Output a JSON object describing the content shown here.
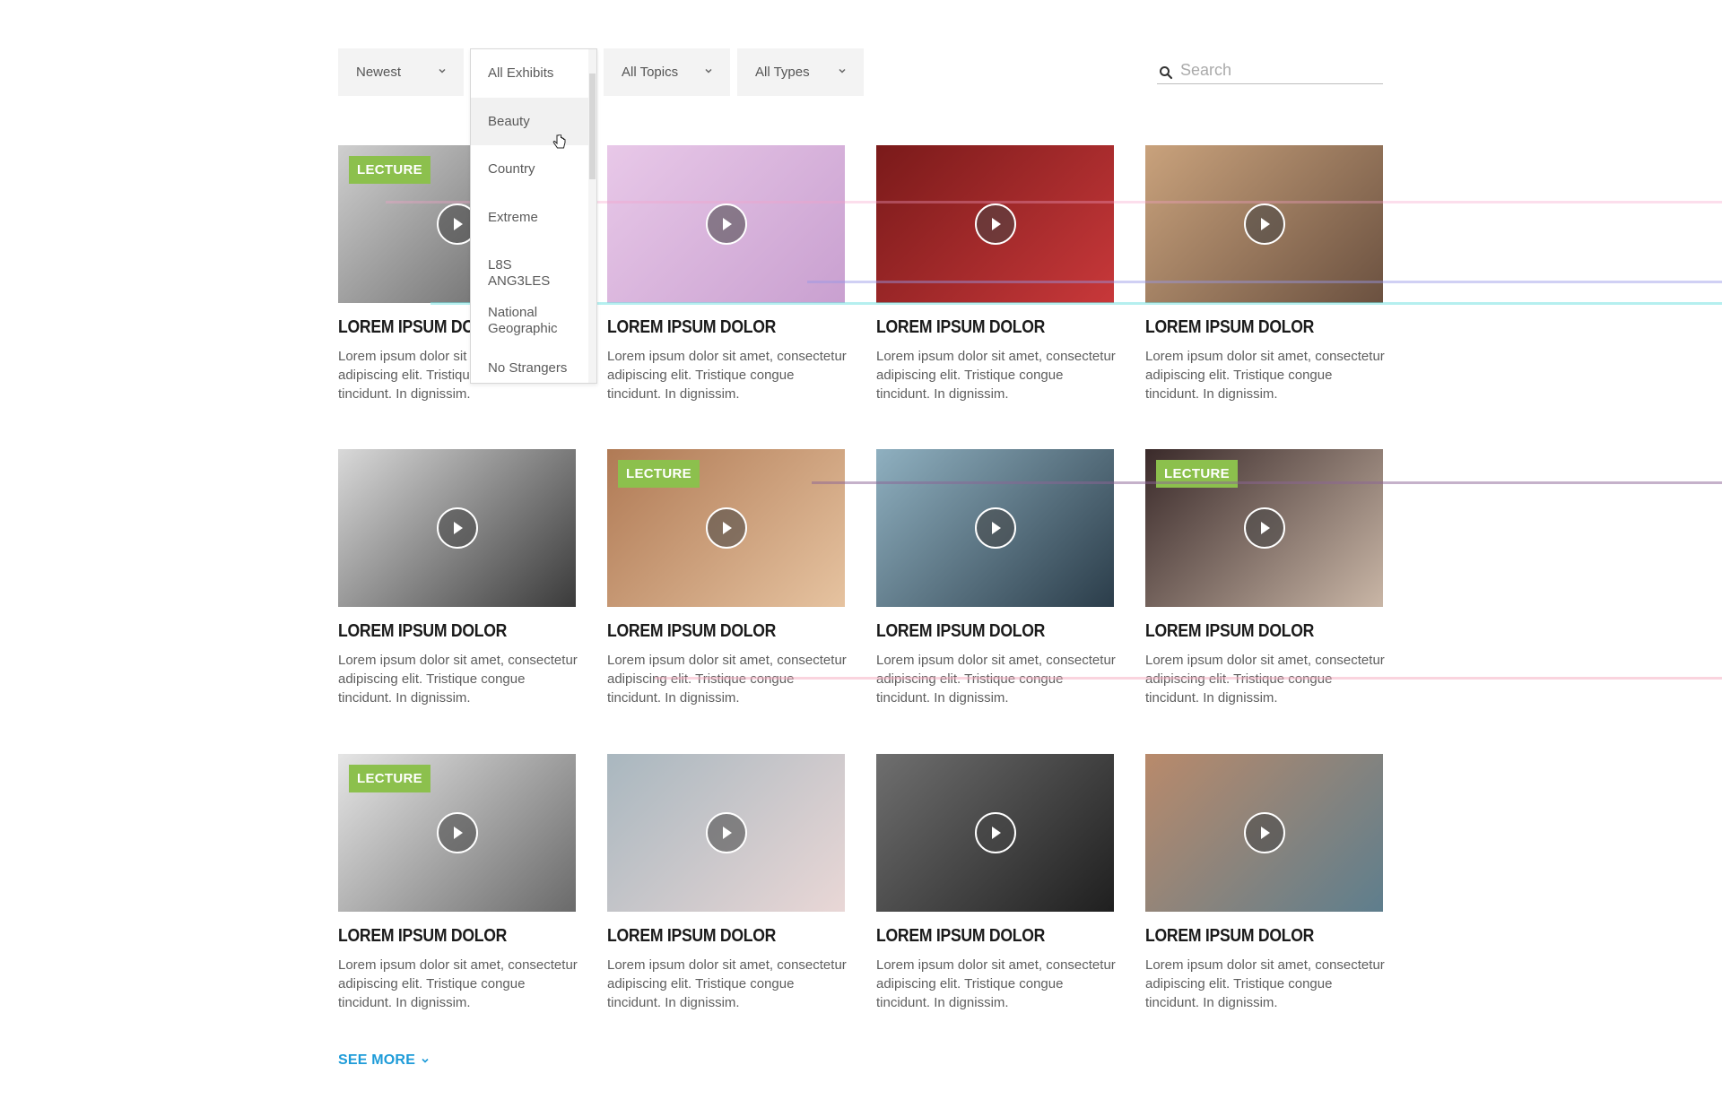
{
  "filters": {
    "sort": {
      "label": "Newest"
    },
    "exhibits": {
      "label": "All Exhibits",
      "options": [
        "Beauty",
        "Country",
        "Extreme",
        "L8S ANG3LES",
        "National Geographic",
        "No Strangers"
      ]
    },
    "topics": {
      "label": "All Topics"
    },
    "types": {
      "label": "All Types"
    }
  },
  "search": {
    "placeholder": "Search"
  },
  "cards": [
    {
      "badge": "LECTURE",
      "title": "LOREM IPSUM DOLOR",
      "desc": "Lorem ipsum dolor sit amet, consectetur adipiscing elit. Tristique congue tincidunt. In dignissim."
    },
    {
      "badge": "",
      "title": "LOREM IPSUM DOLOR",
      "desc": "Lorem ipsum dolor sit amet, consectetur adipiscing elit. Tristique congue tincidunt. In dignissim."
    },
    {
      "badge": "",
      "title": "LOREM IPSUM DOLOR",
      "desc": "Lorem ipsum dolor sit amet, consectetur adipiscing elit. Tristique congue tincidunt. In dignissim."
    },
    {
      "badge": "",
      "title": "LOREM IPSUM DOLOR",
      "desc": "Lorem ipsum dolor sit amet, consectetur adipiscing elit. Tristique congue tincidunt. In dignissim."
    },
    {
      "badge": "",
      "title": "LOREM IPSUM DOLOR",
      "desc": "Lorem ipsum dolor sit amet, consectetur adipiscing elit. Tristique congue tincidunt. In dignissim."
    },
    {
      "badge": "LECTURE",
      "title": "LOREM IPSUM DOLOR",
      "desc": "Lorem ipsum dolor sit amet, consectetur adipiscing elit. Tristique congue tincidunt. In dignissim."
    },
    {
      "badge": "",
      "title": "LOREM IPSUM DOLOR",
      "desc": "Lorem ipsum dolor sit amet, consectetur adipiscing elit. Tristique congue tincidunt. In dignissim."
    },
    {
      "badge": "LECTURE",
      "title": "LOREM IPSUM DOLOR",
      "desc": "Lorem ipsum dolor sit amet, consectetur adipiscing elit. Tristique congue tincidunt. In dignissim."
    },
    {
      "badge": "LECTURE",
      "title": "LOREM IPSUM DOLOR",
      "desc": "Lorem ipsum dolor sit amet, consectetur adipiscing elit. Tristique congue tincidunt. In dignissim."
    },
    {
      "badge": "",
      "title": "LOREM IPSUM DOLOR",
      "desc": "Lorem ipsum dolor sit amet, consectetur adipiscing elit. Tristique congue tincidunt. In dignissim."
    },
    {
      "badge": "",
      "title": "LOREM IPSUM DOLOR",
      "desc": "Lorem ipsum dolor sit amet, consectetur adipiscing elit. Tristique congue tincidunt. In dignissim."
    },
    {
      "badge": "",
      "title": "LOREM IPSUM DOLOR",
      "desc": "Lorem ipsum dolor sit amet, consectetur adipiscing elit. Tristique congue tincidunt. In dignissim."
    }
  ],
  "see_more": {
    "label": "SEE MORE"
  },
  "colors": {
    "accent": "#1d9bd8",
    "badge": "#8cc04d",
    "filter_bg": "#f3f3f3"
  }
}
